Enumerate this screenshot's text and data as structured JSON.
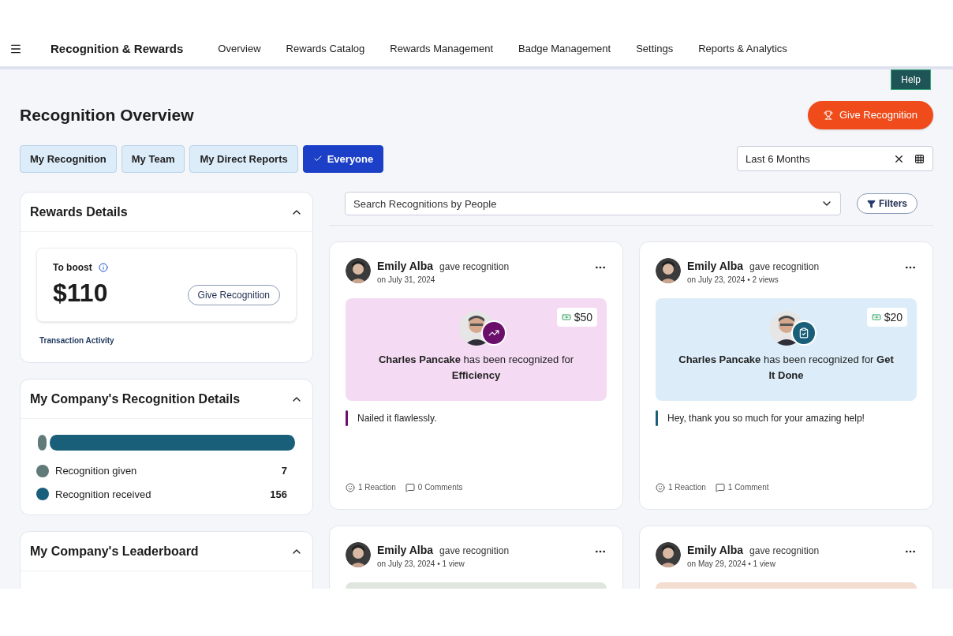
{
  "nav": {
    "title": "Recognition & Rewards",
    "links": [
      {
        "label": "Overview",
        "selected": false
      },
      {
        "label": "Rewards Catalog",
        "selected": false
      },
      {
        "label": "Rewards Management",
        "selected": false
      },
      {
        "label": "Badge Management",
        "selected": false
      },
      {
        "label": "Settings",
        "selected": false
      },
      {
        "label": "Reports & Analytics",
        "selected": false
      }
    ]
  },
  "help": "Help",
  "page_title": "Recognition Overview",
  "give_button": "Give Recognition",
  "filters": [
    {
      "label": "My Recognition",
      "selected": false
    },
    {
      "label": "My Team",
      "selected": false
    },
    {
      "label": "My Direct Reports",
      "selected": false
    },
    {
      "label": "Everyone",
      "selected": true
    }
  ],
  "date_range": {
    "value": "Last 6 Months"
  },
  "rewards": {
    "title": "Rewards Details",
    "expanded": true,
    "boost_label": "To boost",
    "amount": "$110",
    "button": "Give Recognition",
    "link": "Transaction Activity"
  },
  "company": {
    "title": "My Company's Recognition Details",
    "expanded": true,
    "items": [
      {
        "label": "Recognition given",
        "value": "7",
        "level": 0.045,
        "color": "#5f7a78"
      },
      {
        "label": "Recognition received",
        "value": "156",
        "level": 0.955,
        "color": "#1a5f7a"
      }
    ]
  },
  "leaderboard": {
    "title": "My Company's Leaderboard",
    "expanded": true
  },
  "search": {
    "placeholder": "Search Recognitions by People"
  },
  "filters_button": "Filters",
  "cards": [
    {
      "giver": "Emily Alba",
      "action": "gave recognition",
      "meta": "on July 31, 2024",
      "amount": "$50",
      "recipient": "Charles Pancake",
      "sentence": "has been recognized for",
      "award": "Efficiency",
      "kind": "trend",
      "color": "#6b0f6b",
      "message": "Nailed it flawlessly.",
      "reactions": "1 Reaction",
      "comments": "0 Comments"
    },
    {
      "giver": "Emily Alba",
      "action": "gave recognition",
      "meta": "on July 23, 2024 • 2 views",
      "amount": "$20",
      "recipient": "Charles Pancake",
      "sentence": "has been recognized for",
      "award": "Get It Done",
      "kind": "clipboard",
      "color": "#1a5f7a",
      "message": "Hey, thank you so much for your amazing help!",
      "reactions": "1 Reaction",
      "comments": "1 Comment"
    },
    {
      "giver": "Emily Alba",
      "action": "gave recognition",
      "meta": "on July 23, 2024 • 1 view",
      "kind": "partial-green"
    },
    {
      "giver": "Emily Alba",
      "action": "gave recognition",
      "meta": "on May 29, 2024 • 1 view",
      "kind": "partial-orange"
    }
  ]
}
